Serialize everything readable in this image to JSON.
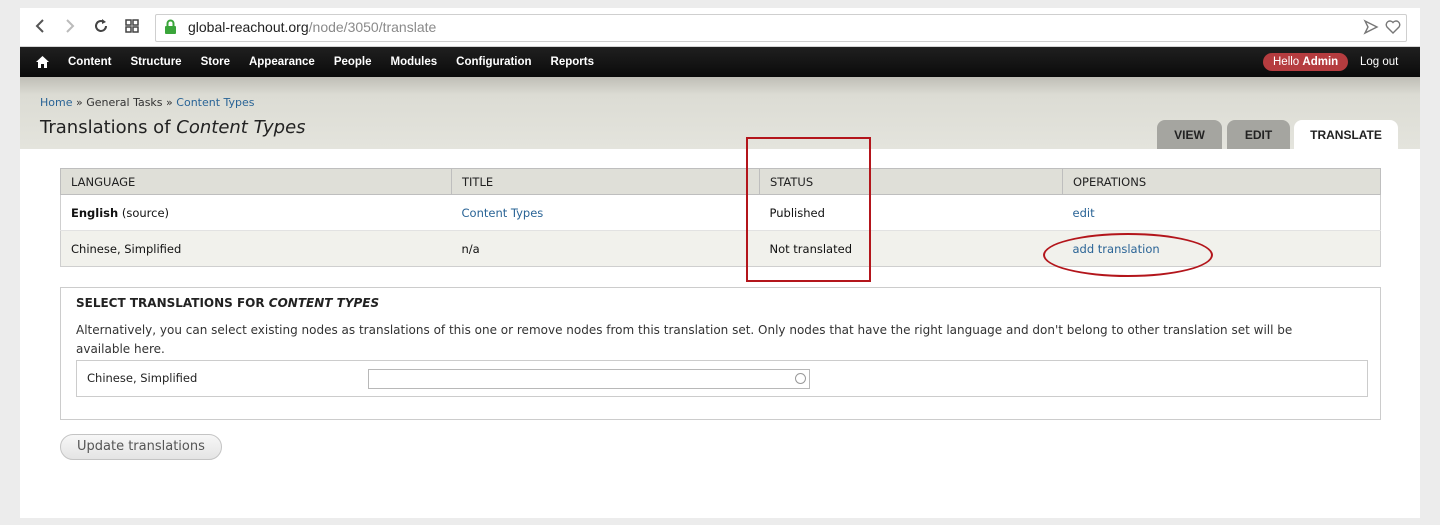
{
  "browser": {
    "url_host": "global-reachout.org",
    "url_path": "/node/3050/translate"
  },
  "admin_toolbar": {
    "items": [
      "Content",
      "Structure",
      "Store",
      "Appearance",
      "People",
      "Modules",
      "Configuration",
      "Reports"
    ],
    "hello_prefix": "Hello",
    "hello_user": "Admin",
    "logout": "Log out"
  },
  "breadcrumb": {
    "home": "Home",
    "sep1": "»",
    "general_tasks": "General Tasks",
    "sep2": "»",
    "content_types": "Content Types"
  },
  "page": {
    "title_prefix": "Translations of",
    "title_emph": "Content Types"
  },
  "tabs": [
    {
      "label": "VIEW",
      "active": false
    },
    {
      "label": "EDIT",
      "active": false
    },
    {
      "label": "TRANSLATE",
      "active": true
    }
  ],
  "table": {
    "headers": [
      "LANGUAGE",
      "TITLE",
      "STATUS",
      "OPERATIONS"
    ],
    "rows": [
      {
        "language": "English",
        "language_suffix": "(source)",
        "title": "Content Types",
        "status": "Published",
        "operation": "edit"
      },
      {
        "language": "Chinese, Simplified",
        "language_suffix": "",
        "title": "n/a",
        "status": "Not translated",
        "operation": "add translation"
      }
    ]
  },
  "select_translations": {
    "legend_prefix": "SELECT TRANSLATIONS FOR",
    "legend_emph": "CONTENT TYPES",
    "description": "Alternatively, you can select existing nodes as translations of this one or remove nodes from this translation set. Only nodes that have the right language and don't belong to other translation set will be available here.",
    "field_label": "Chinese, Simplified",
    "field_value": ""
  },
  "update_button": "Update translations",
  "colors": {
    "annotation": "#b3151b",
    "link": "#2a6496",
    "hello_badge": "#b53c3f"
  }
}
